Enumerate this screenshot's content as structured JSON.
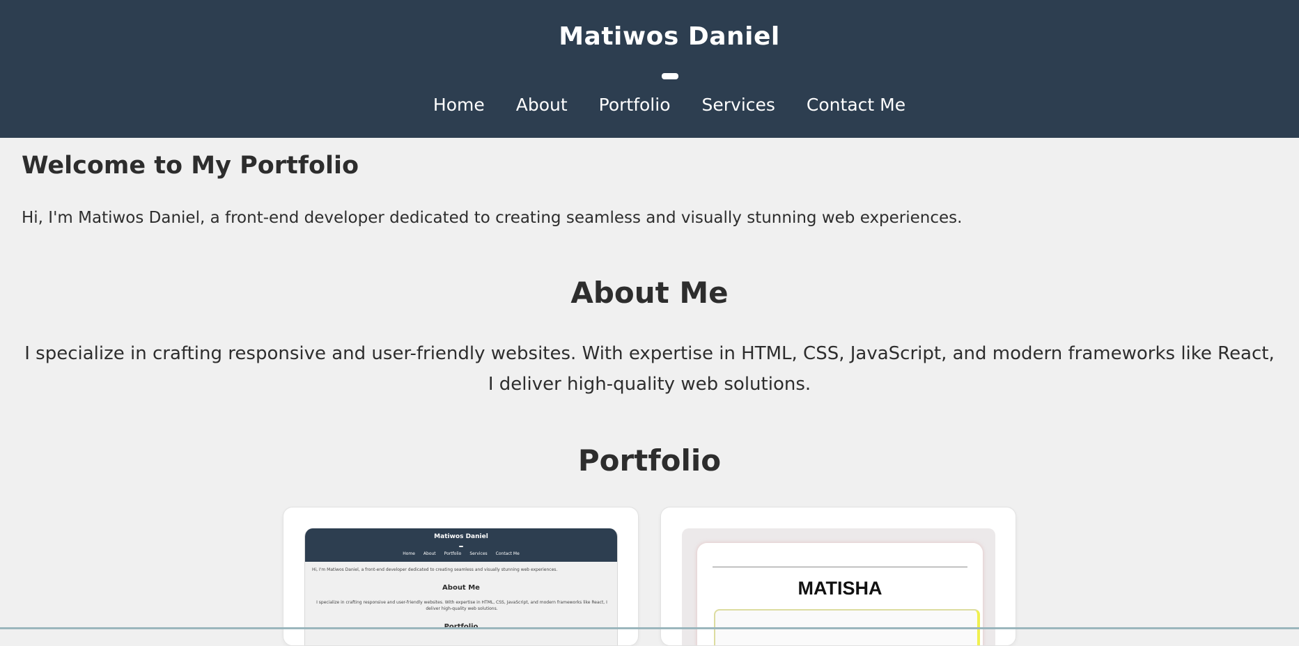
{
  "header": {
    "title": "Matiwos Daniel",
    "nav": [
      {
        "label": "Home"
      },
      {
        "label": "About"
      },
      {
        "label": "Portfolio"
      },
      {
        "label": "Services"
      },
      {
        "label": "Contact Me"
      }
    ]
  },
  "hero": {
    "heading": "Welcome to My Portfolio",
    "text": "Hi, I'm Matiwos Daniel, a front-end developer dedicated to creating seamless and visually stunning web experiences."
  },
  "about": {
    "heading": "About Me",
    "text": "I specialize in crafting responsive and user-friendly websites. With expertise in HTML, CSS, JavaScript, and modern frameworks like React, I deliver high-quality web solutions."
  },
  "portfolio": {
    "heading": "Portfolio",
    "cards": [
      {
        "thumb_title": "Matiwos Daniel",
        "thumb_nav": [
          "Home",
          "About",
          "Portfolio",
          "Services",
          "Contact Me"
        ],
        "thumb_intro": "Hi, I'm Matiwos Daniel, a front-end developer dedicated to creating seamless and visually stunning web experiences.",
        "thumb_about_heading": "About Me",
        "thumb_about_text": "I specialize in crafting responsive and user-friendly websites. With expertise in HTML, CSS, JavaScript, and modern frameworks like React, I deliver high-quality web solutions.",
        "thumb_portfolio_heading": "Portfolio"
      },
      {
        "thumb_brand": "MATISHA"
      }
    ]
  },
  "colors": {
    "header_bg": "#2d3e50",
    "page_bg": "#f0f0f0",
    "text": "#2d2d2d"
  }
}
